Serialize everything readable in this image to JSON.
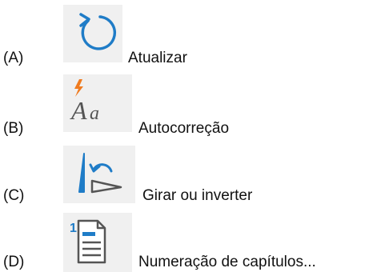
{
  "options": [
    {
      "letter": "(A)",
      "label": "Atualizar",
      "icon": "refresh-icon"
    },
    {
      "letter": "(B)",
      "label": "Autocorreção",
      "icon": "autocorrect-icon"
    },
    {
      "letter": "(C)",
      "label": "Girar ou inverter",
      "icon": "rotate-flip-icon"
    },
    {
      "letter": "(D)",
      "label": "Numeração de capítulos...",
      "icon": "chapter-numbering-icon"
    }
  ],
  "colors": {
    "icon_blue": "#1f7cc7",
    "icon_orange": "#f07b1f",
    "icon_gray": "#555555",
    "tile_bg": "#f0f0f0"
  }
}
